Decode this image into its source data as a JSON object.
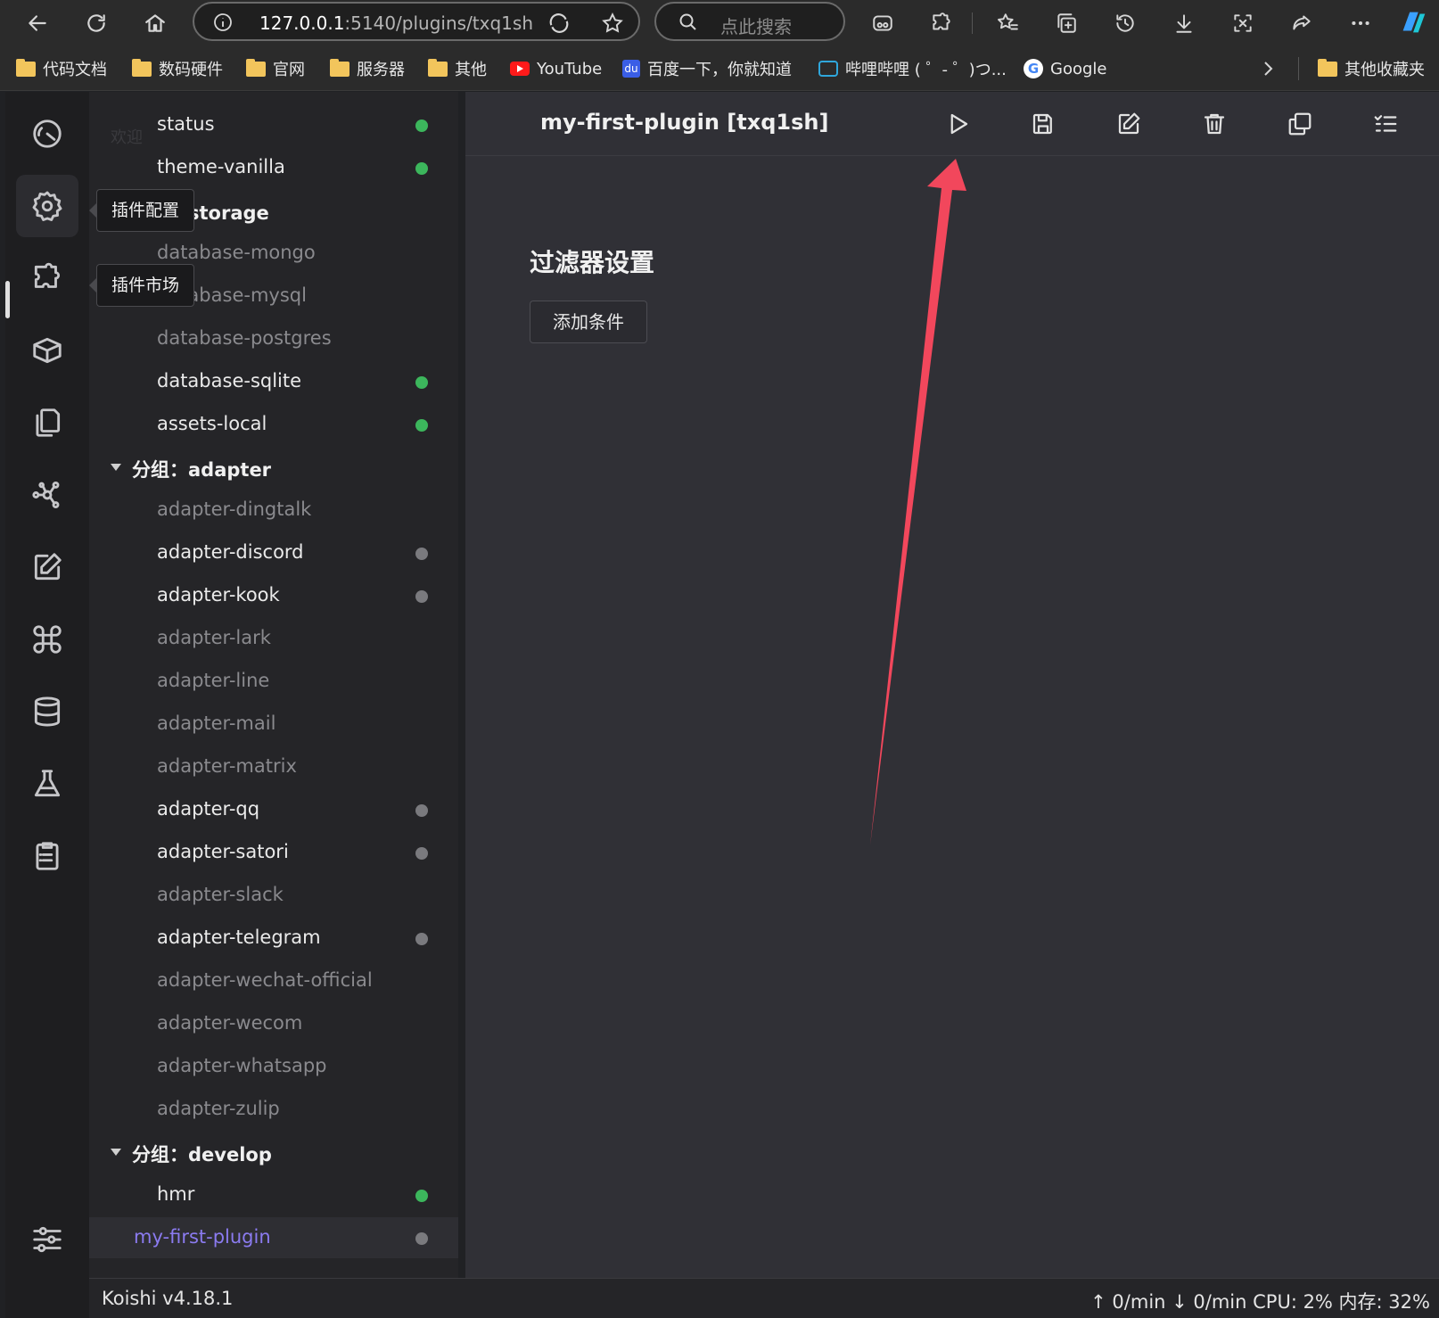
{
  "browser": {
    "url_host": "127.0.0.1",
    "url_rest": ":5140/plugins/txq1sh",
    "search_placeholder": "点此搜索",
    "bookmarks": [
      {
        "label": "代码文档",
        "icon": "folder-icon"
      },
      {
        "label": "数码硬件",
        "icon": "folder-icon"
      },
      {
        "label": "官网",
        "icon": "folder-icon"
      },
      {
        "label": "服务器",
        "icon": "folder-icon"
      },
      {
        "label": "其他",
        "icon": "folder-icon"
      },
      {
        "label": "YouTube",
        "icon": "youtube-icon"
      },
      {
        "label": "百度一下，你就知道",
        "icon": "baidu-icon"
      },
      {
        "label": "哔哩哔哩 ( ゜- ゜)つ...",
        "icon": "bilibili-icon"
      },
      {
        "label": "Google",
        "icon": "google-icon"
      },
      {
        "label": "其他收藏夹",
        "icon": "folder-icon"
      }
    ],
    "baidu_glyph": "du",
    "google_glyph": "G"
  },
  "activity_bar": {
    "tooltips": [
      "插件配置",
      "插件市场"
    ],
    "ghost_label": "欢迎"
  },
  "plugins": [
    {
      "name": "status",
      "enabled": true,
      "status": "green"
    },
    {
      "name": "theme-vanilla",
      "enabled": true,
      "status": "green"
    },
    {
      "name": "分组：storage",
      "group": true
    },
    {
      "name": "database-mongo",
      "enabled": false
    },
    {
      "name": "database-mysql",
      "enabled": false
    },
    {
      "name": "database-postgres",
      "enabled": false
    },
    {
      "name": "database-sqlite",
      "enabled": true,
      "status": "green"
    },
    {
      "name": "assets-local",
      "enabled": true,
      "status": "green"
    },
    {
      "name": "分组：adapter",
      "group": true
    },
    {
      "name": "adapter-dingtalk",
      "enabled": false
    },
    {
      "name": "adapter-discord",
      "enabled": true,
      "status": "grey"
    },
    {
      "name": "adapter-kook",
      "enabled": true,
      "status": "grey"
    },
    {
      "name": "adapter-lark",
      "enabled": false
    },
    {
      "name": "adapter-line",
      "enabled": false
    },
    {
      "name": "adapter-mail",
      "enabled": false
    },
    {
      "name": "adapter-matrix",
      "enabled": false
    },
    {
      "name": "adapter-qq",
      "enabled": true,
      "status": "grey"
    },
    {
      "name": "adapter-satori",
      "enabled": true,
      "status": "grey"
    },
    {
      "name": "adapter-slack",
      "enabled": false
    },
    {
      "name": "adapter-telegram",
      "enabled": true,
      "status": "grey"
    },
    {
      "name": "adapter-wechat-official",
      "enabled": false
    },
    {
      "name": "adapter-wecom",
      "enabled": false
    },
    {
      "name": "adapter-whatsapp",
      "enabled": false
    },
    {
      "name": "adapter-zulip",
      "enabled": false
    },
    {
      "name": "分组：develop",
      "group": true
    },
    {
      "name": "hmr",
      "enabled": true,
      "status": "green"
    },
    {
      "name": "my-first-plugin",
      "enabled": true,
      "status": "grey",
      "selected": true
    }
  ],
  "main": {
    "title": "my-first-plugin [txq1sh]",
    "section_title": "过滤器设置",
    "add_button": "添加条件"
  },
  "statusbar": {
    "version": "Koishi v4.18.1",
    "stats": "↑ 0/min ↓ 0/min    CPU: 2% 内存: 32%"
  },
  "colors": {
    "accent": "#8b7bf0",
    "status_green": "#3cb65c",
    "status_grey": "#7a7a7e",
    "annotation_arrow": "#f2475c"
  }
}
